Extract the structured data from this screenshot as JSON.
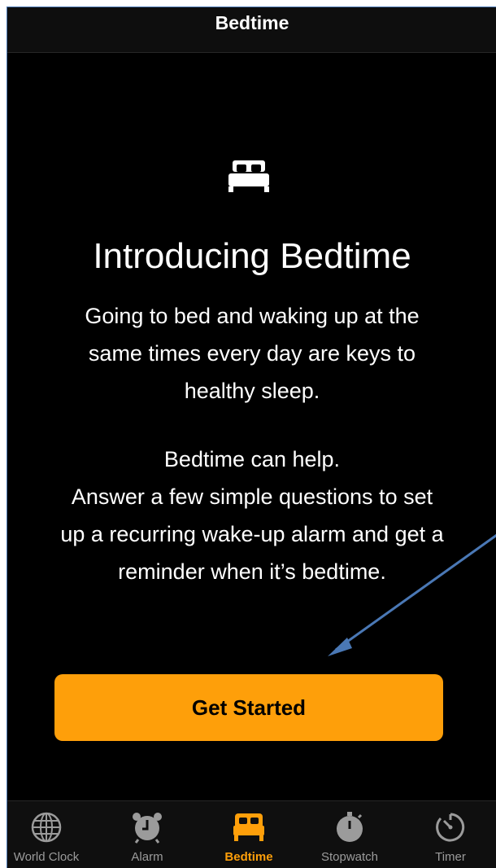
{
  "nav": {
    "title": "Bedtime"
  },
  "intro": {
    "hero_icon": "bed-icon",
    "title": "Introducing Bedtime",
    "paragraph1_line1": "Going to bed and waking up at the",
    "paragraph1_line2": "same times every day are keys to",
    "paragraph1_line3": "healthy sleep.",
    "paragraph2_line1": "Bedtime can help.",
    "paragraph2_line2": "Answer a few simple questions to set",
    "paragraph2_line3": "up a recurring wake-up alarm and get a",
    "paragraph2_line4": "reminder when it’s bedtime."
  },
  "cta": {
    "label": "Get Started"
  },
  "tabs": [
    {
      "label": "World Clock",
      "icon": "globe-icon",
      "active": false
    },
    {
      "label": "Alarm",
      "icon": "alarm-clock-icon",
      "active": false
    },
    {
      "label": "Bedtime",
      "icon": "bed-icon",
      "active": true
    },
    {
      "label": "Stopwatch",
      "icon": "stopwatch-icon",
      "active": false
    },
    {
      "label": "Timer",
      "icon": "timer-icon",
      "active": false
    }
  ],
  "colors": {
    "accent": "#fe9f0a",
    "background": "#000000",
    "annotation_arrow": "#4a78b5",
    "inactive_tab": "#9b9b9b"
  }
}
